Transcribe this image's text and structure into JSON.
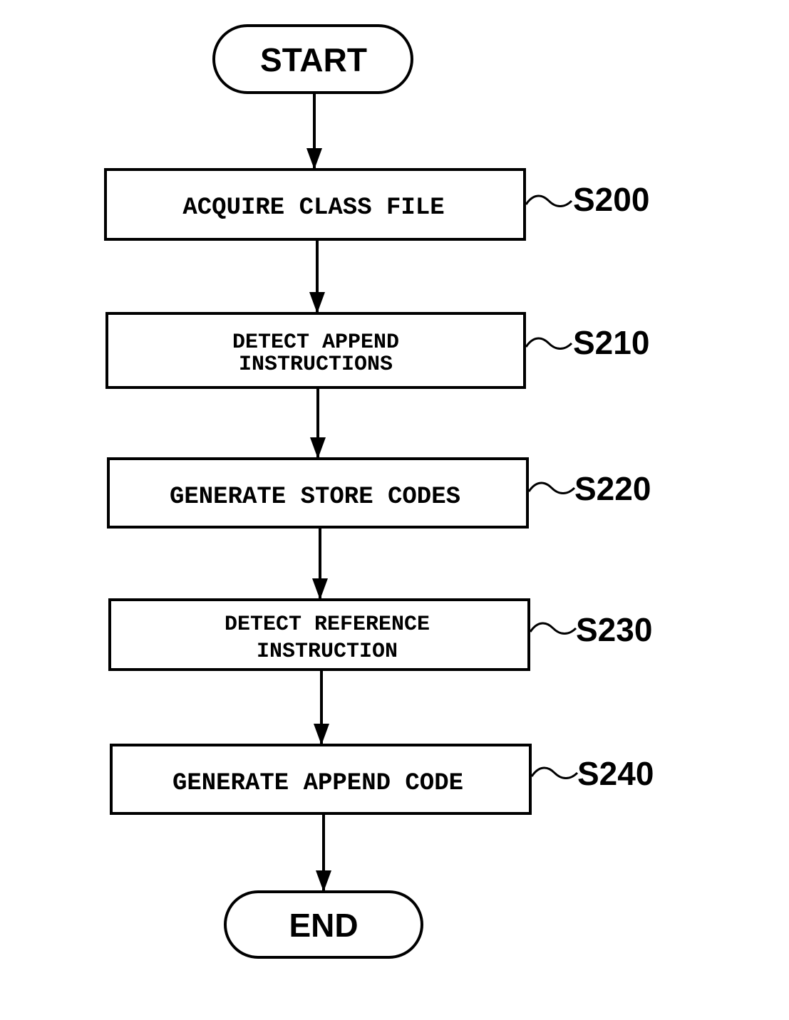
{
  "figure": {
    "type": "flowchart",
    "start": {
      "label": "START"
    },
    "end": {
      "label": "END"
    },
    "steps": [
      {
        "id": "S200",
        "lines": [
          "ACQUIRE CLASS FILE"
        ]
      },
      {
        "id": "S210",
        "lines": [
          "DETECT APPEND",
          "INSTRUCTIONS"
        ]
      },
      {
        "id": "S220",
        "lines": [
          "GENERATE STORE CODES"
        ]
      },
      {
        "id": "S230",
        "lines": [
          "DETECT REFERENCE",
          "INSTRUCTION"
        ]
      },
      {
        "id": "S240",
        "lines": [
          "GENERATE APPEND CODE"
        ]
      }
    ]
  }
}
